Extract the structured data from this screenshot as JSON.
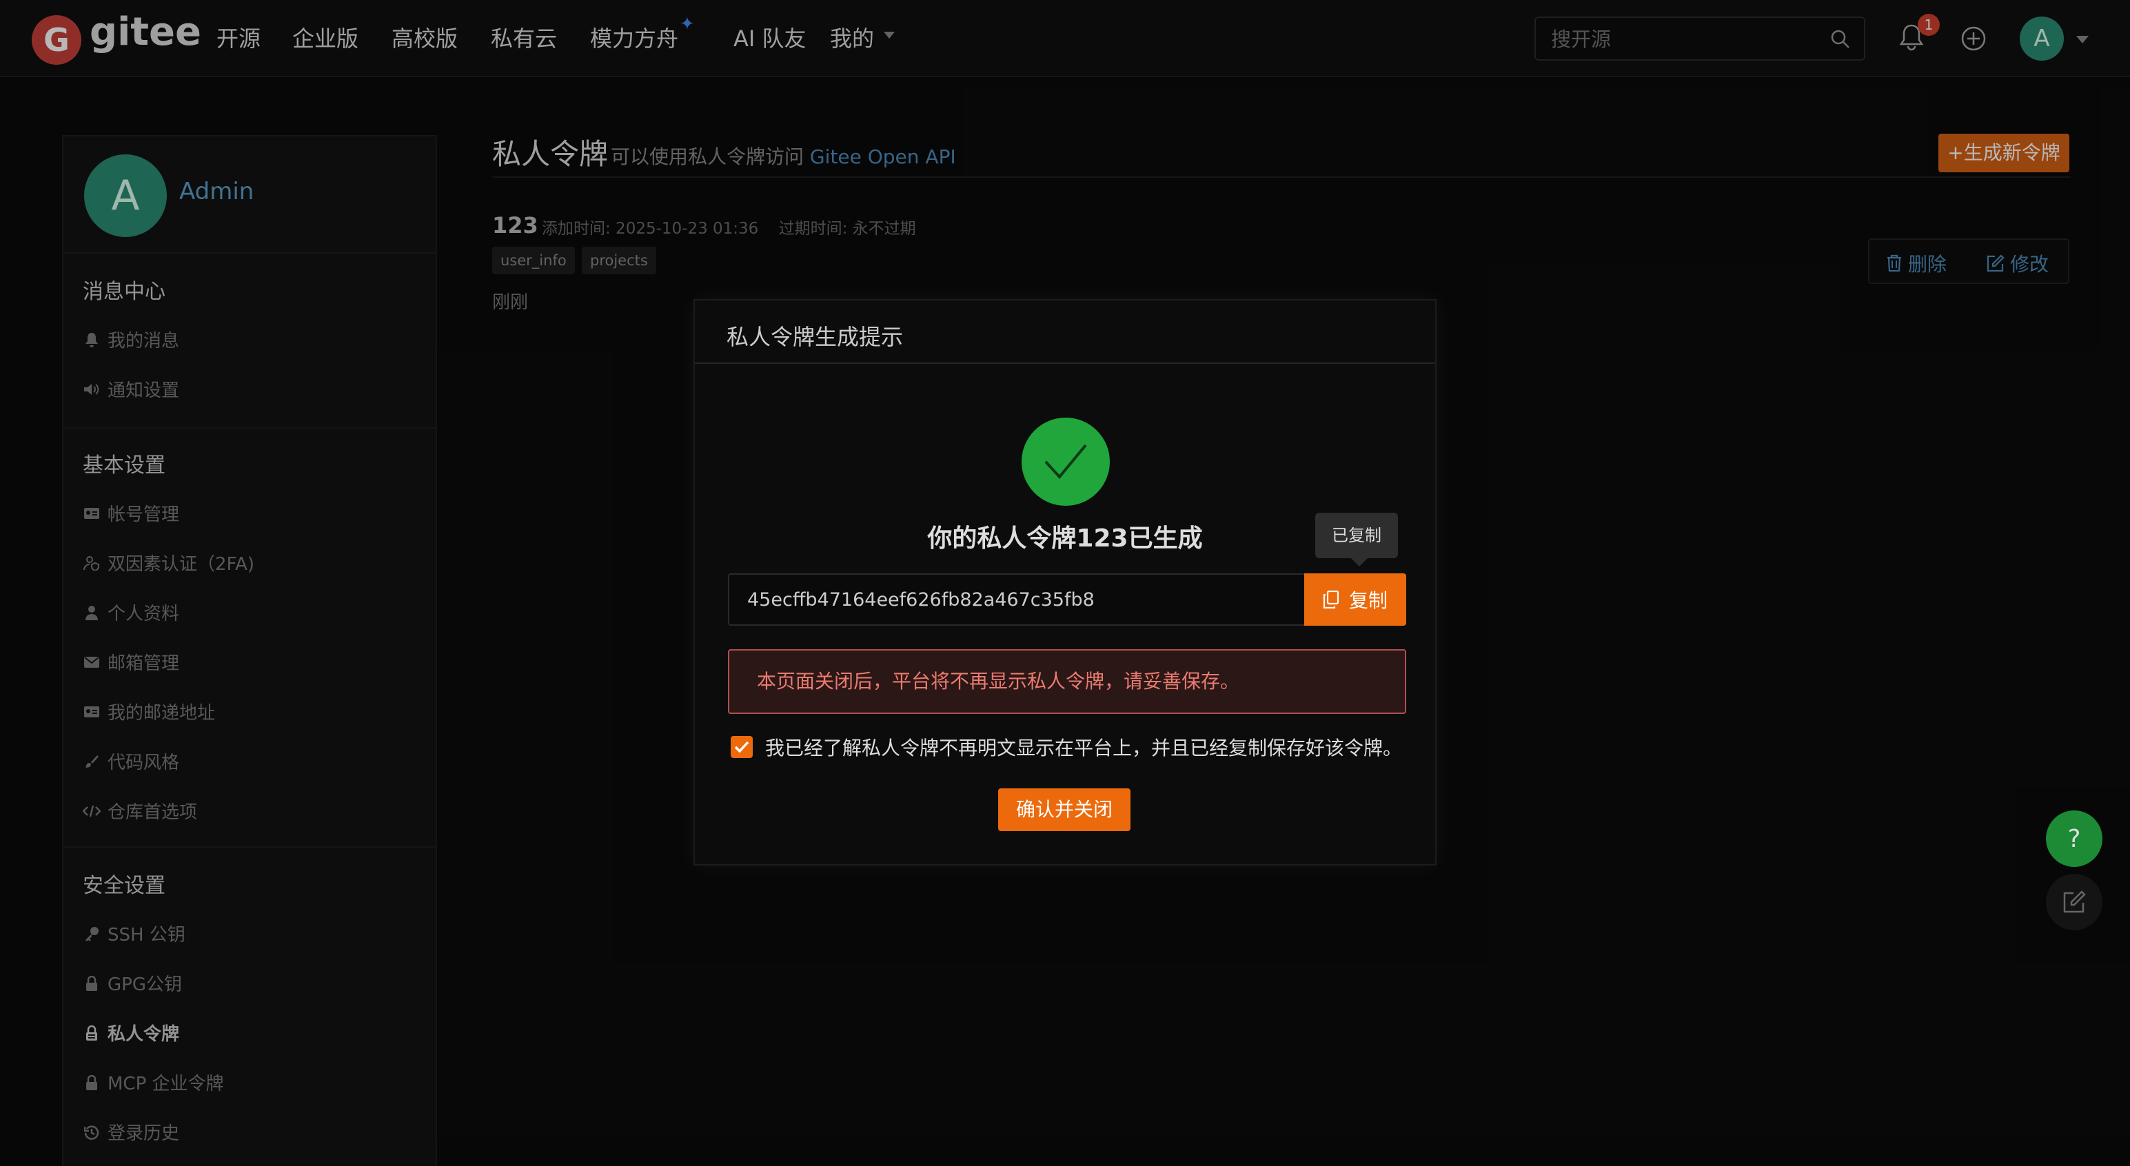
{
  "nav": {
    "logo_letter": "G",
    "logo_text": "gitee",
    "links": [
      "开源",
      "企业版",
      "高校版",
      "私有云",
      "模力方舟",
      "AI 队友",
      "我的"
    ],
    "search_placeholder": "搜开源",
    "notification_count": "1",
    "avatar_letter": "A"
  },
  "sidebar": {
    "avatar_letter": "A",
    "username": "Admin",
    "sections": [
      {
        "title": "消息中心",
        "items": [
          {
            "icon": "bell-icon",
            "label": "我的消息"
          },
          {
            "icon": "volume-icon",
            "label": "通知设置"
          }
        ]
      },
      {
        "title": "基本设置",
        "items": [
          {
            "icon": "id-card-icon",
            "label": "帐号管理"
          },
          {
            "icon": "user-shield-icon",
            "label": "双因素认证（2FA)"
          },
          {
            "icon": "user-icon",
            "label": "个人资料"
          },
          {
            "icon": "envelope-icon",
            "label": "邮箱管理"
          },
          {
            "icon": "address-card-icon",
            "label": "我的邮递地址"
          },
          {
            "icon": "brush-icon",
            "label": "代码风格"
          },
          {
            "icon": "code-icon",
            "label": "仓库首选项"
          }
        ]
      },
      {
        "title": "安全设置",
        "items": [
          {
            "icon": "key-icon",
            "label": "SSH 公钥"
          },
          {
            "icon": "lock-icon",
            "label": "GPG公钥"
          },
          {
            "icon": "token-lock-icon",
            "label": "私人令牌",
            "active": true
          },
          {
            "icon": "token-lock-icon",
            "label": "MCP 企业令牌"
          },
          {
            "icon": "history-icon",
            "label": "登录历史"
          }
        ]
      }
    ]
  },
  "main": {
    "title": "私人令牌",
    "subtitle": "可以使用私人令牌访问",
    "subtitle_link": "Gitee Open API",
    "generate_button": "+生成新令牌",
    "token": {
      "name": "123",
      "meta": "添加时间: 2025-10-23 01:36    过期时间: 永不过期",
      "tags": [
        "user_info",
        "projects"
      ],
      "last_used": "刚刚",
      "delete_label": "删除",
      "edit_label": "修改"
    }
  },
  "modal": {
    "title": "私人令牌生成提示",
    "success_message": "你的私人令牌123已生成",
    "token_value": "45ecffb47164eef626fb82a467c35fb8",
    "copy_label": "复制",
    "tooltip": "已复制",
    "warning": "本页面关闭后，平台将不再显示私人令牌，请妥善保存。",
    "checkbox_checked": true,
    "checkbox_label": "我已经了解私人令牌不再明文显示在平台上，并且已经复制保存好该令牌。",
    "confirm_label": "确认并关闭"
  },
  "colors": {
    "accent": "#ec6a0c",
    "success": "#20a63a",
    "link": "#4d8dbd",
    "warning_text": "#ea7b6f",
    "avatar": "#2a8c73"
  }
}
